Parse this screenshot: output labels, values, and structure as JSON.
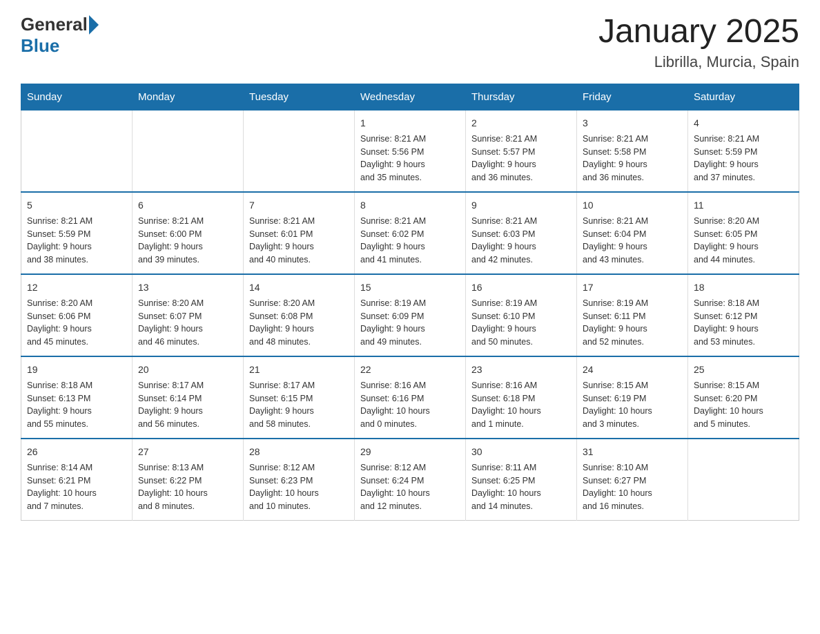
{
  "header": {
    "logo_general": "General",
    "logo_blue": "Blue",
    "title": "January 2025",
    "subtitle": "Librilla, Murcia, Spain"
  },
  "days_of_week": [
    "Sunday",
    "Monday",
    "Tuesday",
    "Wednesday",
    "Thursday",
    "Friday",
    "Saturday"
  ],
  "weeks": [
    [
      {
        "num": "",
        "info": ""
      },
      {
        "num": "",
        "info": ""
      },
      {
        "num": "",
        "info": ""
      },
      {
        "num": "1",
        "info": "Sunrise: 8:21 AM\nSunset: 5:56 PM\nDaylight: 9 hours\nand 35 minutes."
      },
      {
        "num": "2",
        "info": "Sunrise: 8:21 AM\nSunset: 5:57 PM\nDaylight: 9 hours\nand 36 minutes."
      },
      {
        "num": "3",
        "info": "Sunrise: 8:21 AM\nSunset: 5:58 PM\nDaylight: 9 hours\nand 36 minutes."
      },
      {
        "num": "4",
        "info": "Sunrise: 8:21 AM\nSunset: 5:59 PM\nDaylight: 9 hours\nand 37 minutes."
      }
    ],
    [
      {
        "num": "5",
        "info": "Sunrise: 8:21 AM\nSunset: 5:59 PM\nDaylight: 9 hours\nand 38 minutes."
      },
      {
        "num": "6",
        "info": "Sunrise: 8:21 AM\nSunset: 6:00 PM\nDaylight: 9 hours\nand 39 minutes."
      },
      {
        "num": "7",
        "info": "Sunrise: 8:21 AM\nSunset: 6:01 PM\nDaylight: 9 hours\nand 40 minutes."
      },
      {
        "num": "8",
        "info": "Sunrise: 8:21 AM\nSunset: 6:02 PM\nDaylight: 9 hours\nand 41 minutes."
      },
      {
        "num": "9",
        "info": "Sunrise: 8:21 AM\nSunset: 6:03 PM\nDaylight: 9 hours\nand 42 minutes."
      },
      {
        "num": "10",
        "info": "Sunrise: 8:21 AM\nSunset: 6:04 PM\nDaylight: 9 hours\nand 43 minutes."
      },
      {
        "num": "11",
        "info": "Sunrise: 8:20 AM\nSunset: 6:05 PM\nDaylight: 9 hours\nand 44 minutes."
      }
    ],
    [
      {
        "num": "12",
        "info": "Sunrise: 8:20 AM\nSunset: 6:06 PM\nDaylight: 9 hours\nand 45 minutes."
      },
      {
        "num": "13",
        "info": "Sunrise: 8:20 AM\nSunset: 6:07 PM\nDaylight: 9 hours\nand 46 minutes."
      },
      {
        "num": "14",
        "info": "Sunrise: 8:20 AM\nSunset: 6:08 PM\nDaylight: 9 hours\nand 48 minutes."
      },
      {
        "num": "15",
        "info": "Sunrise: 8:19 AM\nSunset: 6:09 PM\nDaylight: 9 hours\nand 49 minutes."
      },
      {
        "num": "16",
        "info": "Sunrise: 8:19 AM\nSunset: 6:10 PM\nDaylight: 9 hours\nand 50 minutes."
      },
      {
        "num": "17",
        "info": "Sunrise: 8:19 AM\nSunset: 6:11 PM\nDaylight: 9 hours\nand 52 minutes."
      },
      {
        "num": "18",
        "info": "Sunrise: 8:18 AM\nSunset: 6:12 PM\nDaylight: 9 hours\nand 53 minutes."
      }
    ],
    [
      {
        "num": "19",
        "info": "Sunrise: 8:18 AM\nSunset: 6:13 PM\nDaylight: 9 hours\nand 55 minutes."
      },
      {
        "num": "20",
        "info": "Sunrise: 8:17 AM\nSunset: 6:14 PM\nDaylight: 9 hours\nand 56 minutes."
      },
      {
        "num": "21",
        "info": "Sunrise: 8:17 AM\nSunset: 6:15 PM\nDaylight: 9 hours\nand 58 minutes."
      },
      {
        "num": "22",
        "info": "Sunrise: 8:16 AM\nSunset: 6:16 PM\nDaylight: 10 hours\nand 0 minutes."
      },
      {
        "num": "23",
        "info": "Sunrise: 8:16 AM\nSunset: 6:18 PM\nDaylight: 10 hours\nand 1 minute."
      },
      {
        "num": "24",
        "info": "Sunrise: 8:15 AM\nSunset: 6:19 PM\nDaylight: 10 hours\nand 3 minutes."
      },
      {
        "num": "25",
        "info": "Sunrise: 8:15 AM\nSunset: 6:20 PM\nDaylight: 10 hours\nand 5 minutes."
      }
    ],
    [
      {
        "num": "26",
        "info": "Sunrise: 8:14 AM\nSunset: 6:21 PM\nDaylight: 10 hours\nand 7 minutes."
      },
      {
        "num": "27",
        "info": "Sunrise: 8:13 AM\nSunset: 6:22 PM\nDaylight: 10 hours\nand 8 minutes."
      },
      {
        "num": "28",
        "info": "Sunrise: 8:12 AM\nSunset: 6:23 PM\nDaylight: 10 hours\nand 10 minutes."
      },
      {
        "num": "29",
        "info": "Sunrise: 8:12 AM\nSunset: 6:24 PM\nDaylight: 10 hours\nand 12 minutes."
      },
      {
        "num": "30",
        "info": "Sunrise: 8:11 AM\nSunset: 6:25 PM\nDaylight: 10 hours\nand 14 minutes."
      },
      {
        "num": "31",
        "info": "Sunrise: 8:10 AM\nSunset: 6:27 PM\nDaylight: 10 hours\nand 16 minutes."
      },
      {
        "num": "",
        "info": ""
      }
    ]
  ]
}
